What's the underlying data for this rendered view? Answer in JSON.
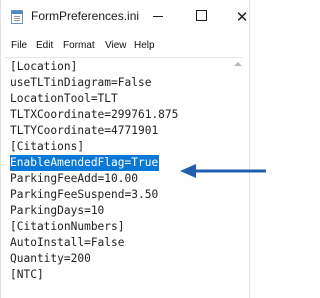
{
  "window": {
    "title": "FormPreferences.ini",
    "minimize_glyph": "",
    "maximize_glyph": "",
    "close_glyph": "✕"
  },
  "menu": {
    "file": "File",
    "edit": "Edit",
    "format": "Format",
    "view": "View",
    "help": "Help"
  },
  "editor": {
    "lines": [
      "[Location]",
      "useTLTinDiagram=False",
      "LocationTool=TLT",
      "TLTXCoordinate=299761.875",
      "TLTYCoordinate=4771901",
      "[Citations]",
      "EnableAmendedFlag=True",
      "ParkingFeeAdd=10.00",
      "ParkingFeeSuspend=3.50",
      "ParkingDays=10",
      "[CitationNumbers]",
      "AutoInstall=False",
      "Quantity=200",
      "[NTC]"
    ],
    "selected_line_index": 6
  },
  "colors": {
    "selection": "#0a78d7",
    "arrow": "#1f5fae"
  },
  "icons": {
    "app": "notepad-icon",
    "arrow": "left-arrow-icon",
    "scroll_up": "scroll-up-arrow-icon"
  }
}
